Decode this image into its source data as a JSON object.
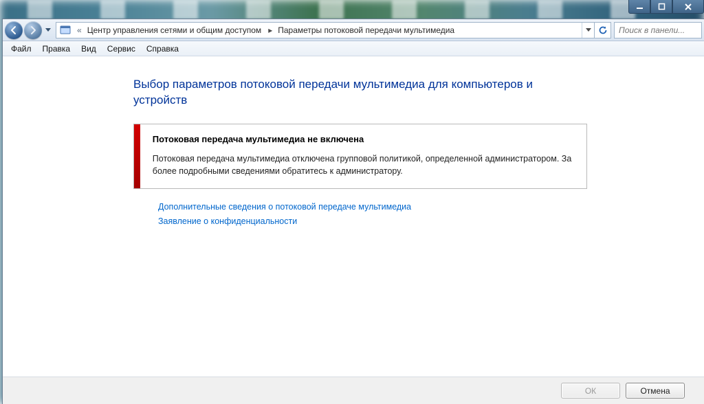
{
  "window_controls": {
    "minimize": "–",
    "maximize": "❐",
    "close": "✕"
  },
  "breadcrumb": {
    "seg1": "Центр управления сетями и общим доступом",
    "seg2": "Параметры потоковой передачи мультимедиа"
  },
  "search": {
    "placeholder": "Поиск в панели..."
  },
  "menu": {
    "file": "Файл",
    "edit": "Правка",
    "view": "Вид",
    "tools": "Сервис",
    "help": "Справка"
  },
  "page": {
    "title": "Выбор параметров потоковой передачи мультимедиа для компьютеров и устройств",
    "alert_title": "Потоковая передача мультимедиа не включена",
    "alert_body": "Потоковая передача мультимедиа отключена групповой политикой, определенной администратором. За более подробными сведениями обратитесь к администратору.",
    "link_more": "Дополнительные сведения о потоковой передаче мультимедиа",
    "link_privacy": "Заявление о конфиденциальности"
  },
  "buttons": {
    "ok": "ОК",
    "cancel": "Отмена"
  }
}
